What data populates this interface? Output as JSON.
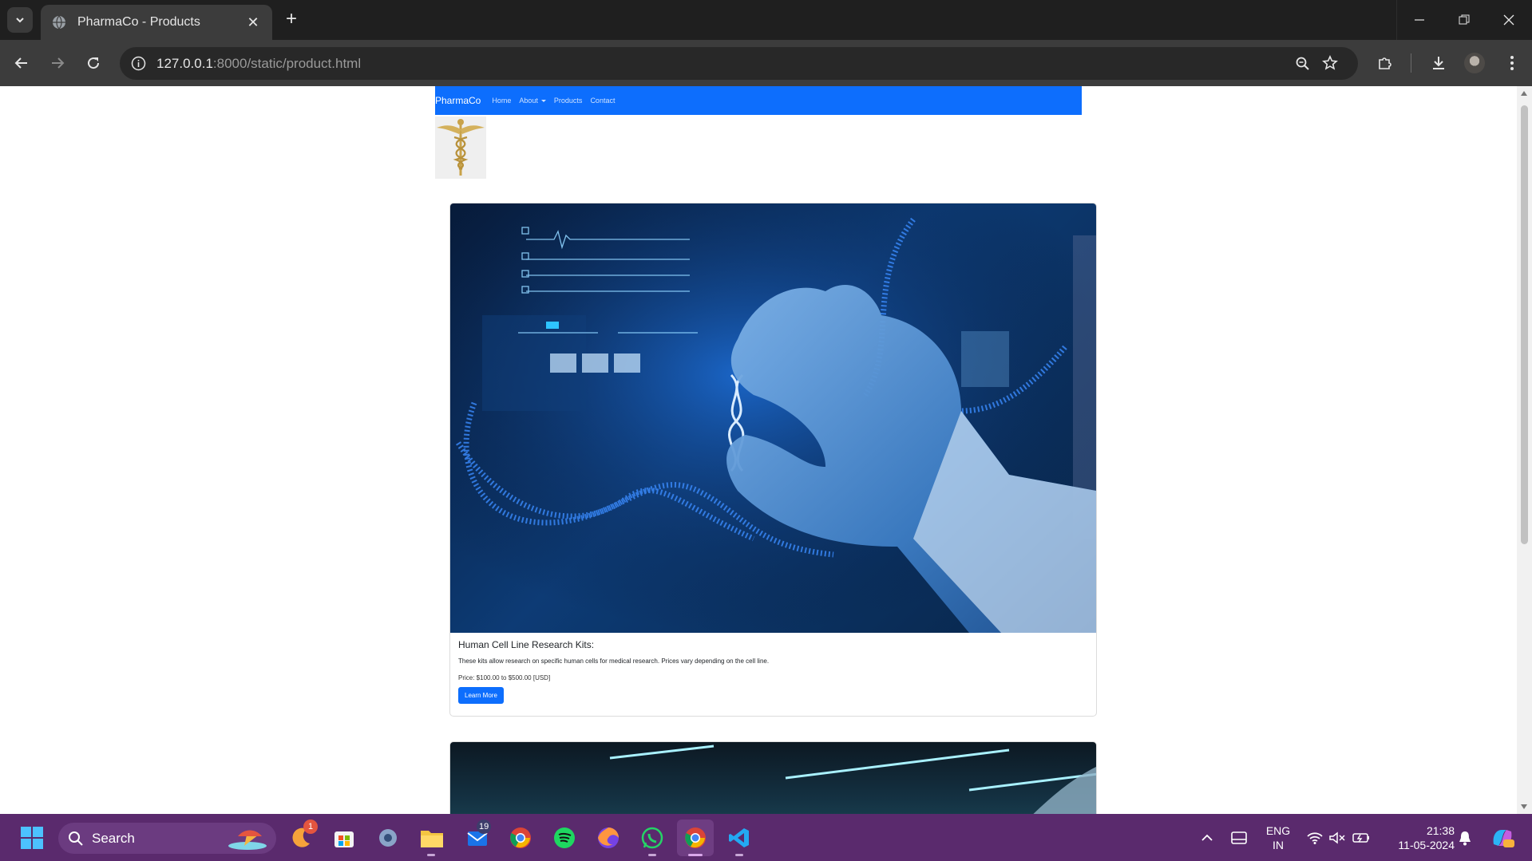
{
  "browser": {
    "tab_title": "PharmaCo - Products",
    "url_host": "127.0.0.1",
    "url_rest": ":8000/static/product.html"
  },
  "site": {
    "brand": "PharmaCo",
    "nav": [
      "Home",
      "About",
      "Products",
      "Contact"
    ]
  },
  "products": [
    {
      "title": "Human Cell Line Research Kits:",
      "description": "These kits allow research on specific human cells for medical research. Prices vary depending on the cell line.",
      "price": "Price: $100.00 to $500.00 [USD]",
      "button": "Learn More"
    }
  ],
  "taskbar": {
    "search_label": "Search",
    "badge_widget": "1",
    "badge_mail": "19",
    "lang_1": "ENG",
    "lang_2": "IN",
    "time": "21:38",
    "date": "11-05-2024"
  },
  "colors": {
    "navbar": "#0d6efd",
    "button": "#0d6efd",
    "taskbar": "#5a2a6d"
  }
}
